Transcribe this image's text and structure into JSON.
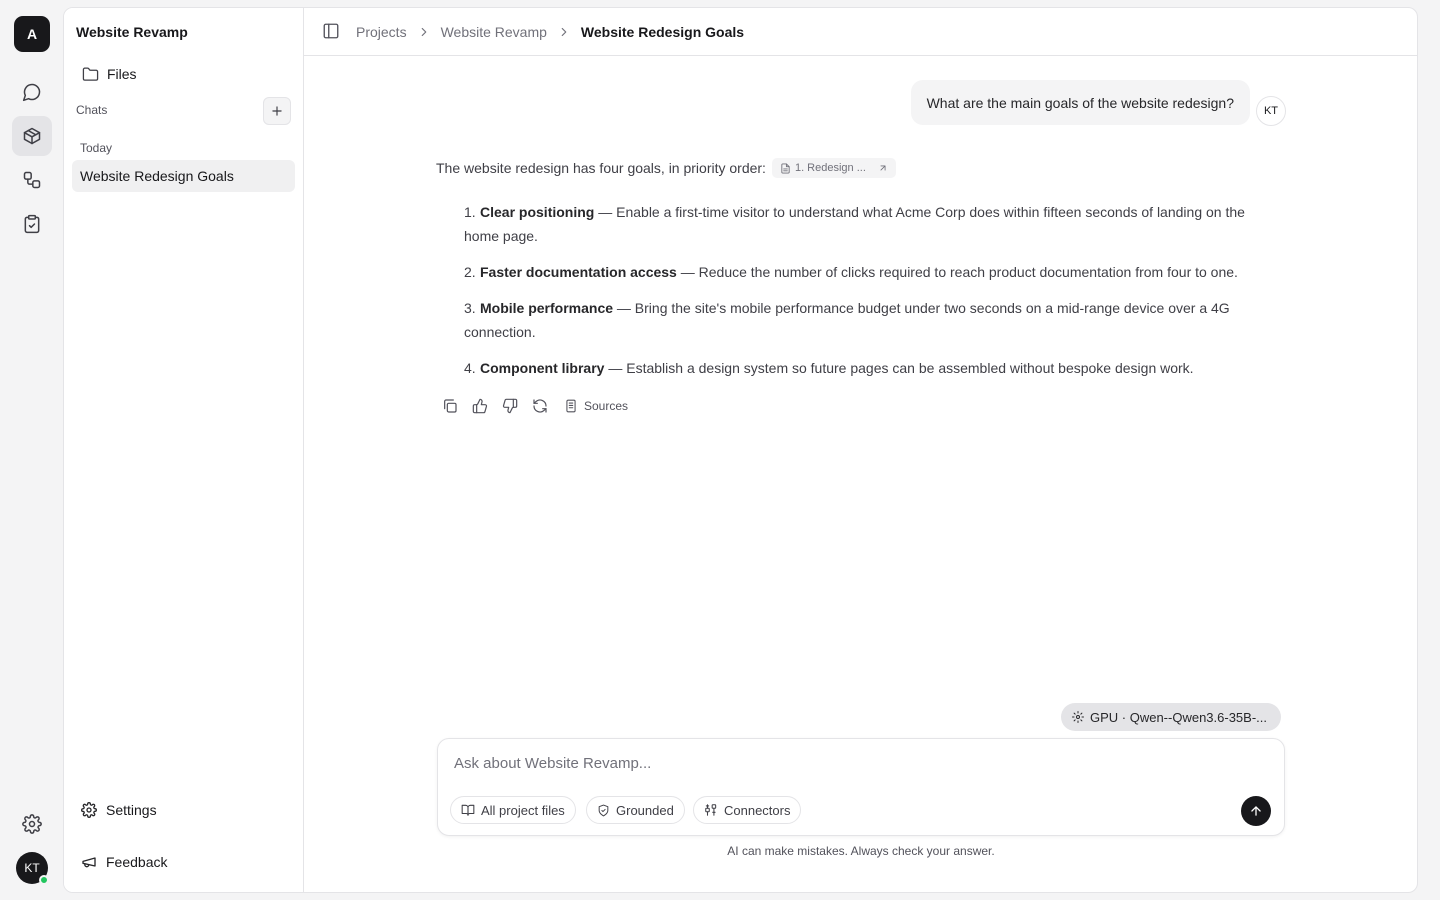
{
  "rail": {
    "logo": "A",
    "avatar_initials": "KT",
    "icons": [
      "chat-icon",
      "project-cube-icon",
      "workflow-icon",
      "clipboard-check-icon",
      "gear-icon"
    ]
  },
  "sidebar": {
    "project_title": "Website Revamp",
    "files_label": "Files",
    "chats_label": "Chats",
    "today_label": "Today",
    "chat_items": [
      {
        "label": "Website Redesign Goals"
      }
    ],
    "settings_label": "Settings",
    "feedback_label": "Feedback"
  },
  "breadcrumb": {
    "items": [
      "Projects",
      "Website Revamp",
      "Website Redesign Goals"
    ]
  },
  "conversation": {
    "user_initials": "KT",
    "user_message": "What are the main goals of the website redesign?",
    "answer_intro": "The website redesign has four goals, in priority order:",
    "citation": "1. Redesign ...",
    "goals": [
      {
        "num": "1.",
        "title": "Clear positioning",
        "text": " — Enable a first-time visitor to understand what Acme Corp does within fifteen seconds of landing on the home page."
      },
      {
        "num": "2.",
        "title": "Faster documentation access",
        "text": " — Reduce the number of clicks required to reach product documentation from four to one."
      },
      {
        "num": "3.",
        "title": "Mobile performance",
        "text": " — Bring the site's mobile performance budget under two seconds on a mid-range device over a 4G connection."
      },
      {
        "num": "4.",
        "title": "Component library",
        "text": " — Establish a design system so future pages can be assembled without bespoke design work."
      }
    ],
    "sources_label": "Sources"
  },
  "composer": {
    "model_label": "GPU · Qwen--Qwen3.6-35B-...",
    "placeholder": "Ask about Website Revamp...",
    "value": "",
    "pills": [
      "All project files",
      "Grounded",
      "Connectors"
    ],
    "disclaimer": "AI can make mistakes. Always check your answer."
  }
}
